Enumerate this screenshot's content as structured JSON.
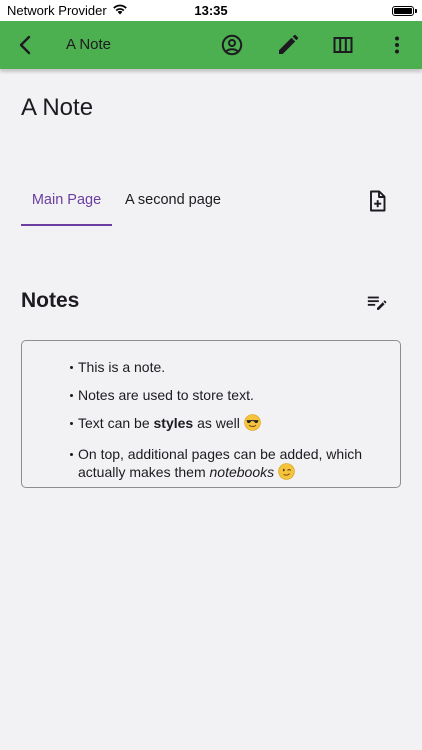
{
  "status_bar": {
    "carrier": "Network Provider",
    "time": "13:35"
  },
  "app_bar": {
    "title": "A Note",
    "color": "#4caf50",
    "icons": [
      "back-icon",
      "account-circle-icon",
      "edit-pencil-icon",
      "columns-icon",
      "more-vert-icon"
    ]
  },
  "page": {
    "title": "A Note"
  },
  "tabs": [
    {
      "label": "Main Page",
      "selected": true
    },
    {
      "label": "A second page",
      "selected": false
    }
  ],
  "add_page_icon": "note-add-icon",
  "notes_section": {
    "title": "Notes",
    "edit_icon": "edit-list-icon",
    "items": [
      {
        "parts": [
          {
            "text": "This is a note."
          }
        ]
      },
      {
        "parts": [
          {
            "text": "Notes are used to store text."
          }
        ]
      },
      {
        "parts": [
          {
            "text": "Text can be "
          },
          {
            "text": "styles",
            "style": "bold"
          },
          {
            "text": " as well"
          }
        ],
        "emoji": "sunglasses-emoji"
      },
      {
        "parts": [
          {
            "text": "On top, additional pages can be added, which actually makes them "
          },
          {
            "text": "notebooks",
            "style": "italic"
          }
        ],
        "emoji": "wink-emoji"
      }
    ]
  },
  "colors": {
    "accent": "#6b3fa0",
    "background": "#f2f1f4",
    "text": "#1d1b20"
  }
}
